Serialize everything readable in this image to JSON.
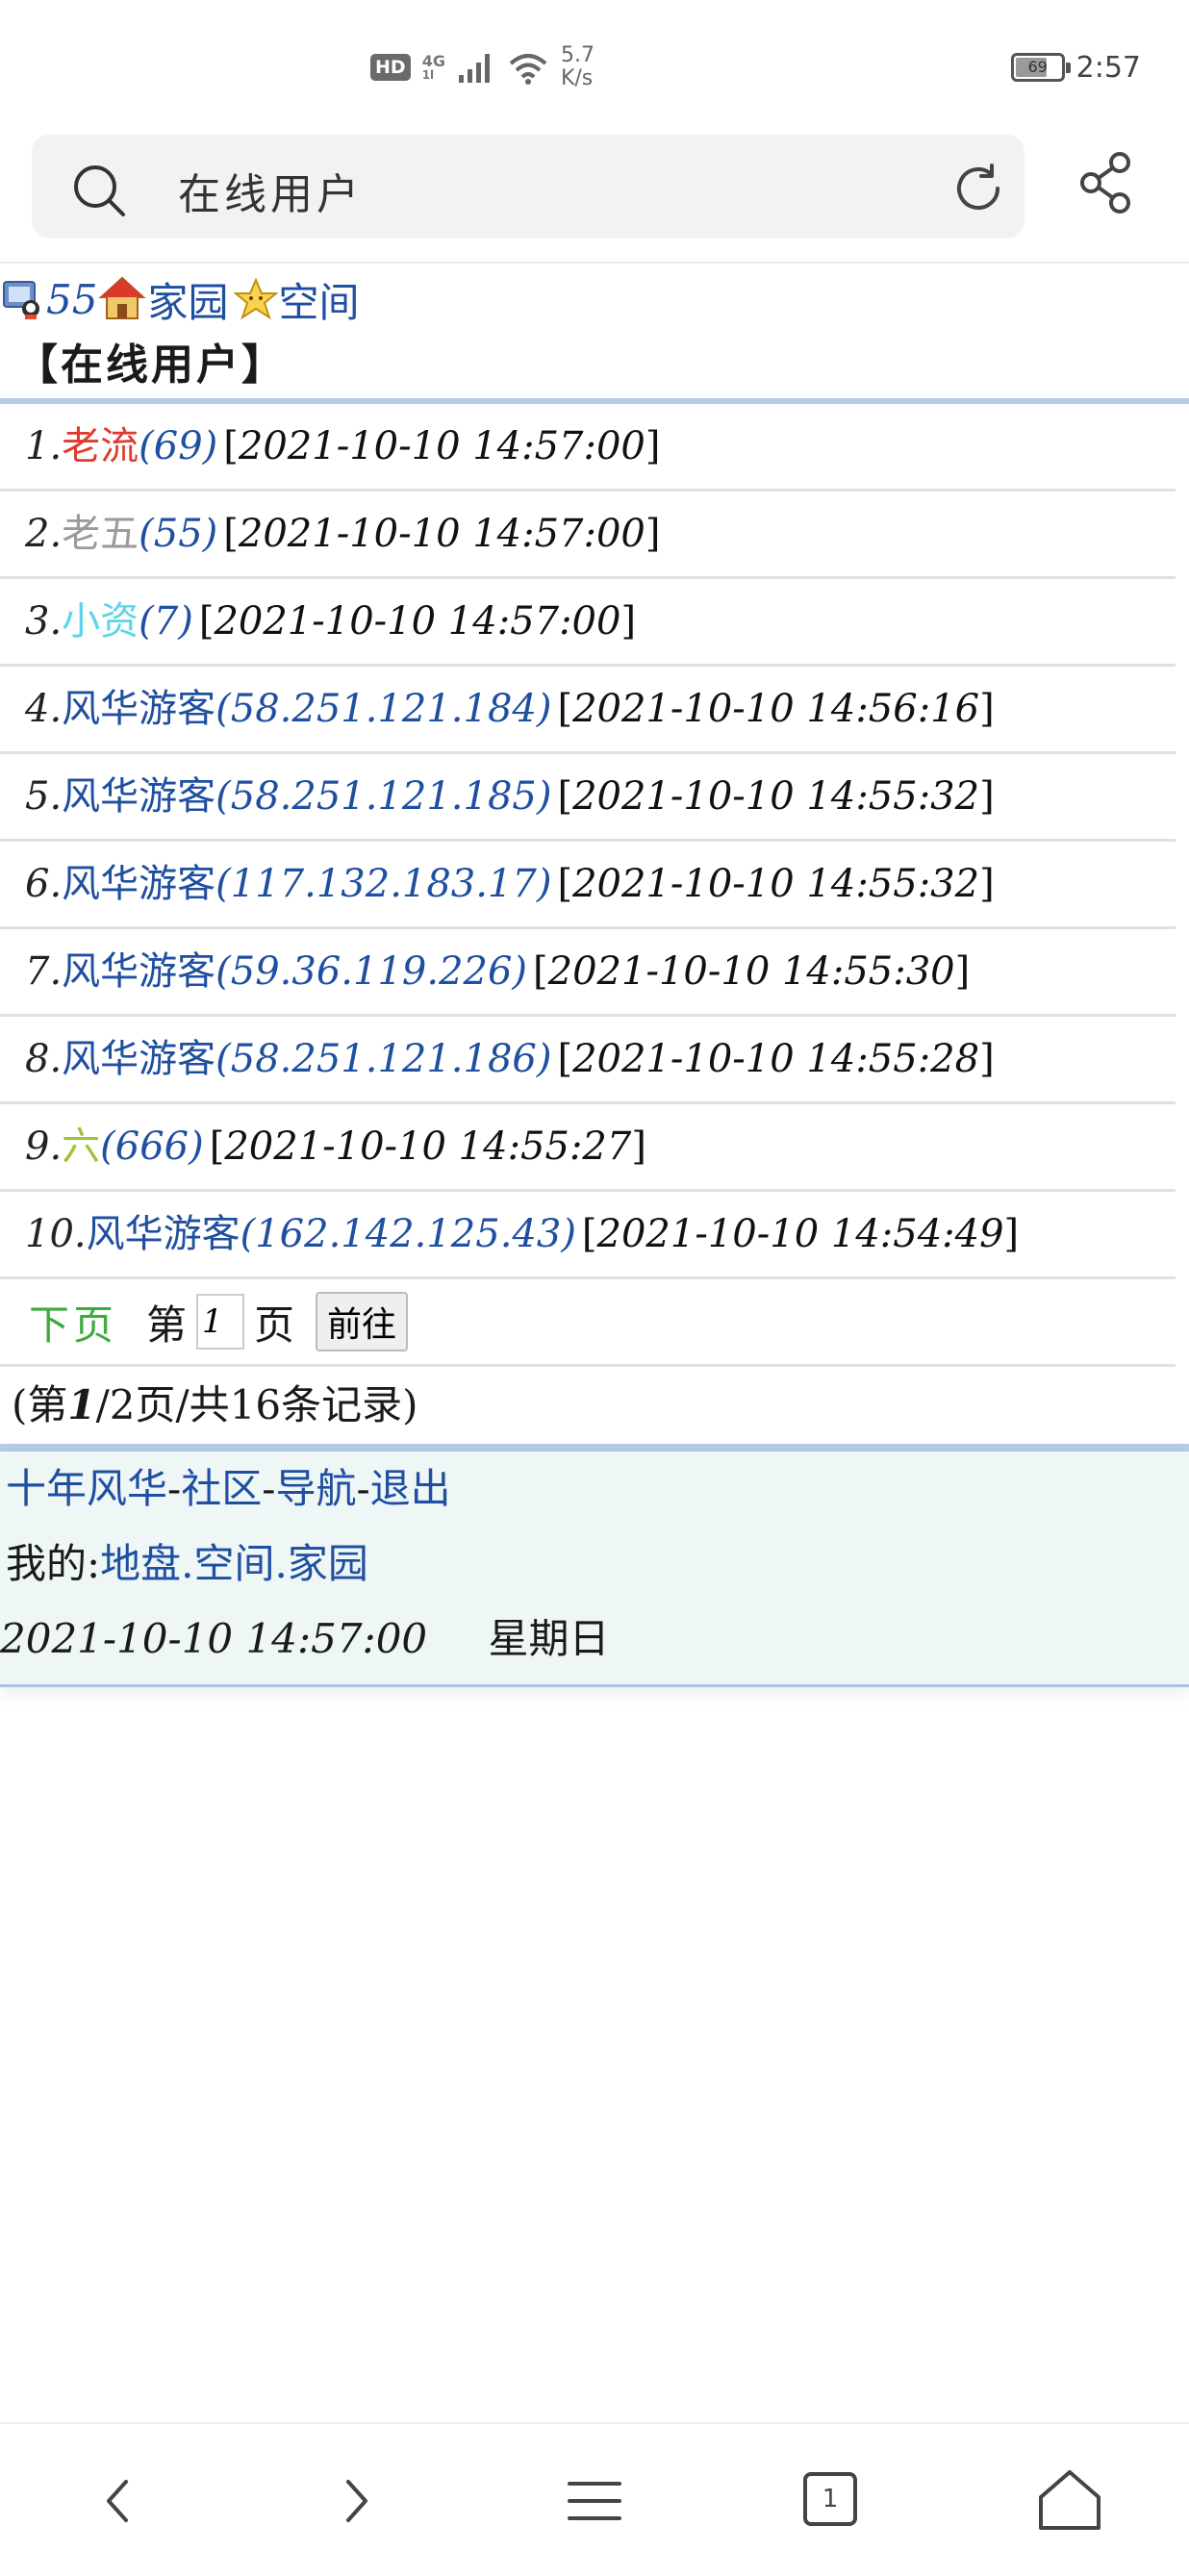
{
  "status": {
    "hd": "HD",
    "network_top": "4G",
    "network_bottom": "1l",
    "speed_value": "5.7",
    "speed_unit": "K/s",
    "battery": "69",
    "battery_level": 0.69,
    "time": "2:57"
  },
  "search": {
    "value": "在线用户"
  },
  "header": {
    "count": "55",
    "home_label": "家园",
    "space_label": "空间"
  },
  "page_title": "【在线用户】",
  "users": [
    {
      "idx": "1.",
      "name": "老流",
      "name_color": "#e03a2f",
      "uid": "(69)",
      "time": "2021-10-10 14:57:00"
    },
    {
      "idx": "2.",
      "name": "老五",
      "name_color": "#9a9a9a",
      "uid": "(55)",
      "time": "2021-10-10 14:57:00"
    },
    {
      "idx": "3.",
      "name": "小资",
      "name_color": "#5ad6e8",
      "uid": "(7)",
      "time": "2021-10-10 14:57:00"
    },
    {
      "idx": "4.",
      "name": "风华游客",
      "name_color": "#1f4fa0",
      "uid": "(58.251.121.184)",
      "time": "2021-10-10 14:56:16"
    },
    {
      "idx": "5.",
      "name": "风华游客",
      "name_color": "#1f4fa0",
      "uid": "(58.251.121.185)",
      "time": "2021-10-10 14:55:32"
    },
    {
      "idx": "6.",
      "name": "风华游客",
      "name_color": "#1f4fa0",
      "uid": "(117.132.183.17)",
      "time": "2021-10-10 14:55:32"
    },
    {
      "idx": "7.",
      "name": "风华游客",
      "name_color": "#1f4fa0",
      "uid": "(59.36.119.226)",
      "time": "2021-10-10 14:55:30"
    },
    {
      "idx": "8.",
      "name": "风华游客",
      "name_color": "#1f4fa0",
      "uid": "(58.251.121.186)",
      "time": "2021-10-10 14:55:28"
    },
    {
      "idx": "9.",
      "name": "六",
      "name_color": "#9fc23a",
      "uid": "(666)",
      "time": "2021-10-10 14:55:27"
    },
    {
      "idx": "10.",
      "name": "风华游客",
      "name_color": "#1f4fa0",
      "uid": "(162.142.125.43)",
      "time": "2021-10-10 14:54:49"
    }
  ],
  "pager": {
    "next": "下页",
    "prefix": "第",
    "page_value": "1",
    "suffix": "页",
    "go": "前往",
    "summary_open": "(第",
    "summary_current": "1",
    "summary_rest": "/2页/共16条记录)"
  },
  "footer": {
    "nav": [
      "十年风华",
      "社区",
      "导航",
      "退出"
    ],
    "sep": "-",
    "mine_label": "我的:",
    "mine_links": [
      "地盘",
      "空间",
      "家园"
    ],
    "mine_sep": ".",
    "datetime": "2021-10-10 14:57:00",
    "weekday": "星期日"
  },
  "bottom_nav": {
    "tabs_count": "1"
  },
  "colors": {
    "link": "#1f4fa0",
    "next": "#3cab3c",
    "rule": "#b5cbe6",
    "footer_bg": "#eef6f6"
  }
}
